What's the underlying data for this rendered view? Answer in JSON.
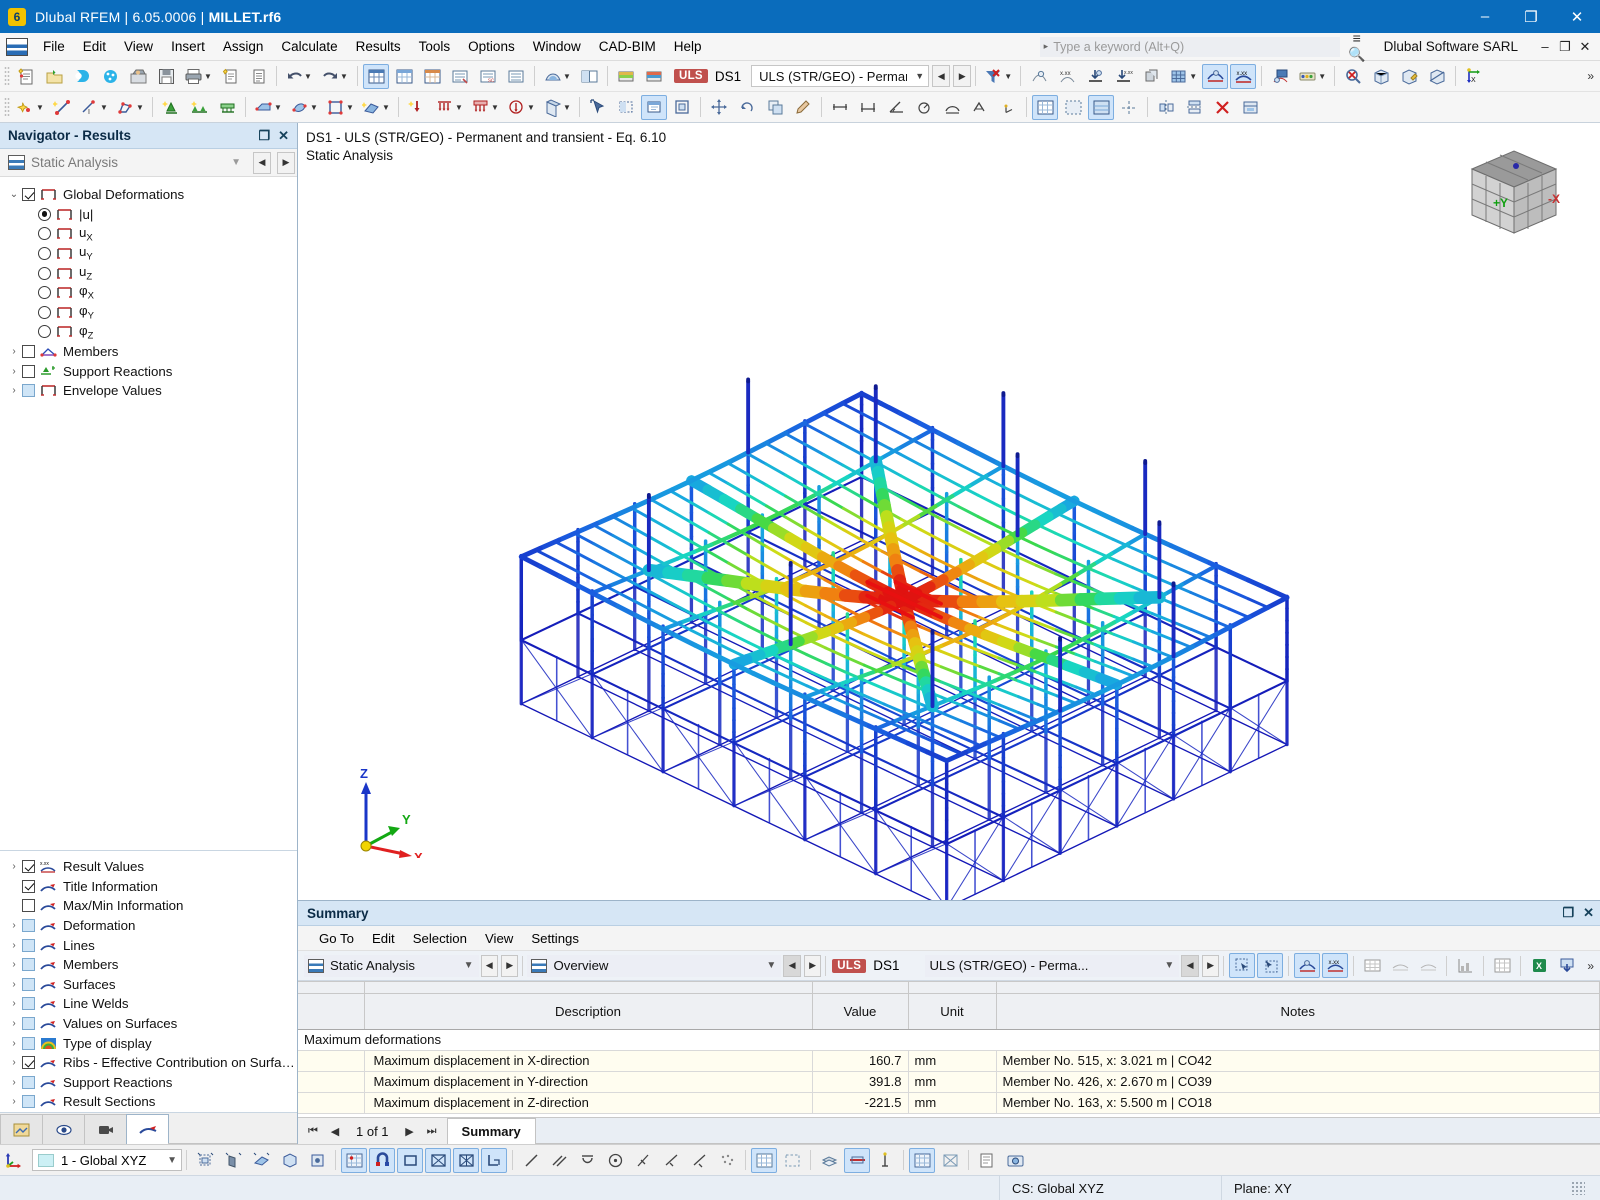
{
  "window": {
    "title_prefix": "Dlubal RFEM | 6.05.0006 | ",
    "title_file": "MILLET.rf6",
    "minimize": "–",
    "maximize": "❐",
    "close": "✕"
  },
  "menubar": {
    "items": [
      "File",
      "Edit",
      "View",
      "Insert",
      "Assign",
      "Calculate",
      "Results",
      "Tools",
      "Options",
      "Window",
      "CAD-BIM",
      "Help"
    ],
    "search_placeholder": "Type a keyword (Alt+Q)",
    "vendor": "Dlubal Software SARL",
    "mini_minimize": "–",
    "mini_restore": "❐",
    "mini_close": "✕"
  },
  "toolbar": {
    "uls_chip": "ULS",
    "design_situation": "DS1",
    "load_case": "ULS (STR/GEO) - Permane...",
    "prev": "◀",
    "next": "▶",
    "overflow": "»"
  },
  "navigator": {
    "title": "Navigator - Results",
    "float_icon": "❐",
    "close_icon": "✕",
    "analysis_type": "Static Analysis",
    "prev": "◀",
    "next": "▶",
    "tree_top": [
      {
        "label": "Global Deformations",
        "type": "checkbox",
        "state": "checked",
        "expander": "⌄",
        "indent": 0,
        "icon": "surface-icon"
      },
      {
        "label": "|u|",
        "type": "radio",
        "state": "on",
        "expander": "",
        "indent": 1,
        "icon": "surface-icon"
      },
      {
        "label": "u",
        "sub": "X",
        "type": "radio",
        "state": "off",
        "expander": "",
        "indent": 1,
        "icon": "surface-icon"
      },
      {
        "label": "u",
        "sub": "Y",
        "type": "radio",
        "state": "off",
        "expander": "",
        "indent": 1,
        "icon": "surface-icon"
      },
      {
        "label": "u",
        "sub": "Z",
        "type": "radio",
        "state": "off",
        "expander": "",
        "indent": 1,
        "icon": "surface-icon"
      },
      {
        "label": "φ",
        "sub": "X",
        "type": "radio",
        "state": "off",
        "expander": "",
        "indent": 1,
        "icon": "surface-icon"
      },
      {
        "label": "φ",
        "sub": "Y",
        "type": "radio",
        "state": "off",
        "expander": "",
        "indent": 1,
        "icon": "surface-icon"
      },
      {
        "label": "φ",
        "sub": "Z",
        "type": "radio",
        "state": "off",
        "expander": "",
        "indent": 1,
        "icon": "surface-icon"
      },
      {
        "label": "Members",
        "type": "checkbox",
        "state": "unchecked",
        "expander": "›",
        "indent": 0,
        "icon": "member-icon"
      },
      {
        "label": "Support Reactions",
        "type": "checkbox",
        "state": "unchecked",
        "expander": "›",
        "indent": 0,
        "icon": "support-icon"
      },
      {
        "label": "Envelope Values",
        "type": "checkbox",
        "state": "blue",
        "expander": "›",
        "indent": 0,
        "icon": "surface-icon"
      }
    ],
    "tree_bottom": [
      {
        "label": "Result Values",
        "state": "checked",
        "expander": "›",
        "icon": "values-icon"
      },
      {
        "label": "Title Information",
        "state": "checked",
        "expander": "",
        "icon": "display-icon"
      },
      {
        "label": "Max/Min Information",
        "state": "unchecked",
        "expander": "",
        "icon": "display-icon"
      },
      {
        "label": "Deformation",
        "state": "blue",
        "expander": "›",
        "icon": "display-icon"
      },
      {
        "label": "Lines",
        "state": "blue",
        "expander": "›",
        "icon": "display-icon"
      },
      {
        "label": "Members",
        "state": "blue",
        "expander": "›",
        "icon": "display-icon"
      },
      {
        "label": "Surfaces",
        "state": "blue",
        "expander": "›",
        "icon": "display-icon"
      },
      {
        "label": "Line Welds",
        "state": "blue",
        "expander": "›",
        "icon": "display-icon"
      },
      {
        "label": "Values on Surfaces",
        "state": "blue",
        "expander": "›",
        "icon": "display-icon"
      },
      {
        "label": "Type of display",
        "state": "blue",
        "expander": "›",
        "icon": "rainbow-icon"
      },
      {
        "label": "Ribs - Effective Contribution on Surfac...",
        "state": "checked",
        "expander": "›",
        "icon": "display-icon"
      },
      {
        "label": "Support Reactions",
        "state": "blue",
        "expander": "›",
        "icon": "display-icon"
      },
      {
        "label": "Result Sections",
        "state": "blue",
        "expander": "›",
        "icon": "display-icon"
      }
    ]
  },
  "viewport": {
    "title_line1": "DS1 - ULS (STR/GEO) - Permanent and transient - Eq. 6.10",
    "title_line2": "Static Analysis",
    "cube_face_y": "+Y",
    "cube_face_x": "-X",
    "axis_z": "Z",
    "axis_y": "Y",
    "axis_x": "X"
  },
  "summary": {
    "title": "Summary",
    "float_icon": "❐",
    "close_icon": "✕",
    "menu": [
      "Go To",
      "Edit",
      "Selection",
      "View",
      "Settings"
    ],
    "analysis_type": "Static Analysis",
    "view_mode": "Overview",
    "uls_chip": "ULS",
    "design_situation": "DS1",
    "load_case": "ULS (STR/GEO) - Perma...",
    "prev": "◀",
    "next": "▶",
    "columns": [
      "",
      "Description",
      "Value",
      "Unit",
      "Notes"
    ],
    "group_label": "Maximum deformations",
    "rows": [
      {
        "description": "Maximum displacement in X-direction",
        "value": "160.7",
        "unit": "mm",
        "notes": "Member No. 515, x: 3.021 m | CO42"
      },
      {
        "description": "Maximum displacement in Y-direction",
        "value": "391.8",
        "unit": "mm",
        "notes": "Member No. 426, x: 2.670 m | CO39"
      },
      {
        "description": "Maximum displacement in Z-direction",
        "value": "-221.5",
        "unit": "mm",
        "notes": "Member No. 163, x: 5.500 m | CO18"
      }
    ],
    "pager": {
      "first": "⏮",
      "prev": "◀",
      "page_text": "1 of 1",
      "next": "▶",
      "last": "⏭",
      "tab": "Summary"
    }
  },
  "statusbar": {
    "cs_selector": "1 - Global XYZ",
    "cs_label": "CS: Global XYZ",
    "plane_label": "Plane: XY"
  },
  "colors": {
    "accent_blue": "#0a6cbc",
    "panel_header": "#d6e6f5",
    "uls_red": "#c0504d",
    "highlight_row": "#fffdf0",
    "axis_x": "#e02020",
    "axis_y": "#13a813",
    "axis_z": "#1a36c8"
  }
}
